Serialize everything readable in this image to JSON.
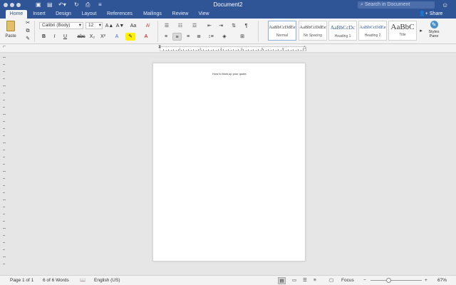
{
  "window": {
    "title": "Document2",
    "search_placeholder": "Search in Document",
    "feedback_icon": "smiley-icon"
  },
  "quick_access": {
    "icons": [
      "sidebar-icon",
      "save-icon",
      "undo-icon",
      "redo-icon",
      "print-icon",
      "customize-icon"
    ]
  },
  "tabs": [
    "Home",
    "Insert",
    "Design",
    "Layout",
    "References",
    "Mailings",
    "Review",
    "View"
  ],
  "active_tab": "Home",
  "share_label": "Share",
  "ribbon": {
    "paste_label": "Paste",
    "font_name": "Calibri (Body)",
    "font_size": "12",
    "font_grow": "A▲",
    "font_shrink": "A▼",
    "change_case": "Aa",
    "bold": "B",
    "italic": "I",
    "underline": "U",
    "strike": "abc",
    "subscript": "X₂",
    "superscript": "X²",
    "pilcrow": "¶",
    "styles": [
      {
        "sample": "AaBbCcDdEe",
        "name": "Normal"
      },
      {
        "sample": "AaBbCcDdEe",
        "name": "No Spacing"
      },
      {
        "sample": "AaBbCcDc",
        "name": "Heading 1"
      },
      {
        "sample": "AaBbCcDdEe",
        "name": "Heading 2"
      },
      {
        "sample": "AaBbC",
        "name": "Title"
      }
    ],
    "styles_pane_label": "Styles Pane"
  },
  "ruler": {
    "numbers": [
      "1",
      "2",
      "3",
      "4",
      "5",
      "6"
    ]
  },
  "document": {
    "text": "How to blow up your quote."
  },
  "status": {
    "page": "Page 1 of 1",
    "words": "6 of 6 Words",
    "language": "English (US)",
    "focus": "Focus",
    "zoom_minus": "−",
    "zoom_plus": "+",
    "zoom_level": "67%",
    "zoom_fraction": 0.35
  },
  "colors": {
    "accent": "#2f5597",
    "ribbon_bg": "#f3f3f3",
    "canvas_bg": "#e6e6e6"
  }
}
